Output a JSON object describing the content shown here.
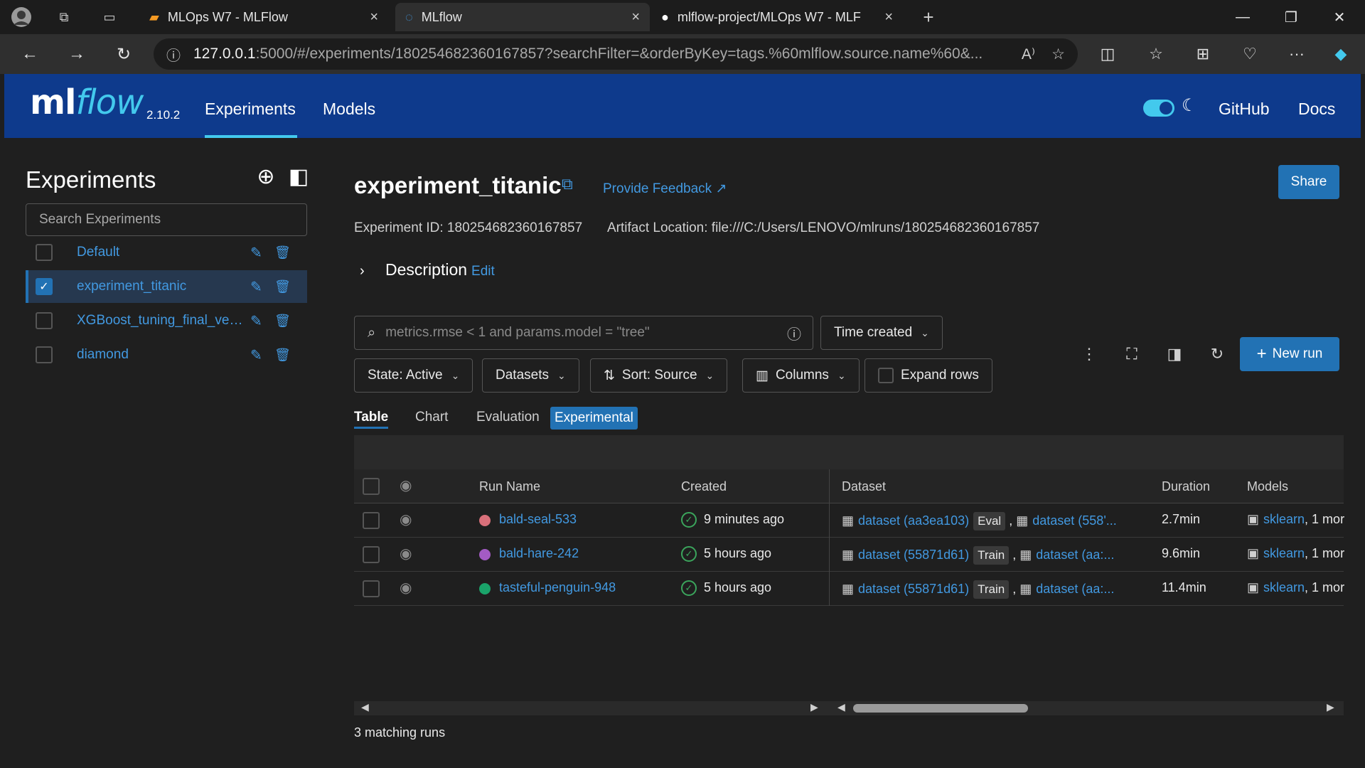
{
  "browser": {
    "tabs": [
      {
        "title": "MLOps W7 - MLFlow",
        "active": false
      },
      {
        "title": "MLflow",
        "active": true
      },
      {
        "title": "mlflow-project/MLOps W7 - MLF",
        "active": false
      }
    ],
    "url_host": "127.0.0.1",
    "url_rest": ":5000/#/experiments/180254682360167857?searchFilter=&orderByKey=tags.%60mlflow.source.name%60&..."
  },
  "header": {
    "logo_ml": "ml",
    "logo_flow": "flow",
    "version": "2.10.2",
    "nav": [
      "Experiments",
      "Models"
    ],
    "github": "GitHub",
    "docs": "Docs"
  },
  "sidebar": {
    "title": "Experiments",
    "search_placeholder": "Search Experiments",
    "experiments": [
      {
        "name": "Default",
        "checked": false
      },
      {
        "name": "experiment_titanic",
        "checked": true
      },
      {
        "name": "XGBoost_tuning_final_ver...",
        "checked": false
      },
      {
        "name": "diamond",
        "checked": false
      }
    ]
  },
  "main": {
    "title": "experiment_titanic",
    "feedback": "Provide Feedback",
    "share": "Share",
    "experiment_id": "Experiment ID: 180254682360167857",
    "artifact_location": "Artifact Location: file:///C:/Users/LENOVO/mlruns/180254682360167857",
    "description": "Description",
    "description_edit": "Edit",
    "search_placeholder": "metrics.rmse < 1 and params.model = \"tree\"",
    "time_created": "Time created",
    "state": "State: Active",
    "datasets": "Datasets",
    "sort": "Sort: Source",
    "columns": "Columns",
    "expand_rows": "Expand rows",
    "new_run": "New run",
    "view_tabs": [
      "Table",
      "Chart",
      "Evaluation"
    ],
    "experimental": "Experimental",
    "matching": "3 matching runs"
  },
  "table": {
    "headers": {
      "run_name": "Run Name",
      "created": "Created",
      "dataset": "Dataset",
      "duration": "Duration",
      "models": "Models"
    },
    "rows": [
      {
        "color": "#d9707a",
        "name": "bald-seal-533",
        "created": "9 minutes ago",
        "ds1": "dataset (aa3ea103)",
        "tag": "Eval",
        "ds2": "dataset (558'...",
        "duration": "2.7min",
        "model": "sklearn",
        "model_more": ", 1 mor"
      },
      {
        "color": "#a35bc4",
        "name": "bald-hare-242",
        "created": "5 hours ago",
        "ds1": "dataset (55871d61)",
        "tag": "Train",
        "ds2": "dataset (aa:...",
        "duration": "9.6min",
        "model": "sklearn",
        "model_more": ", 1 mor"
      },
      {
        "color": "#1aa36a",
        "name": "tasteful-penguin-948",
        "created": "5 hours ago",
        "ds1": "dataset (55871d61)",
        "tag": "Train",
        "ds2": "dataset (aa:...",
        "duration": "11.4min",
        "model": "sklearn",
        "model_more": ", 1 mor"
      }
    ]
  }
}
